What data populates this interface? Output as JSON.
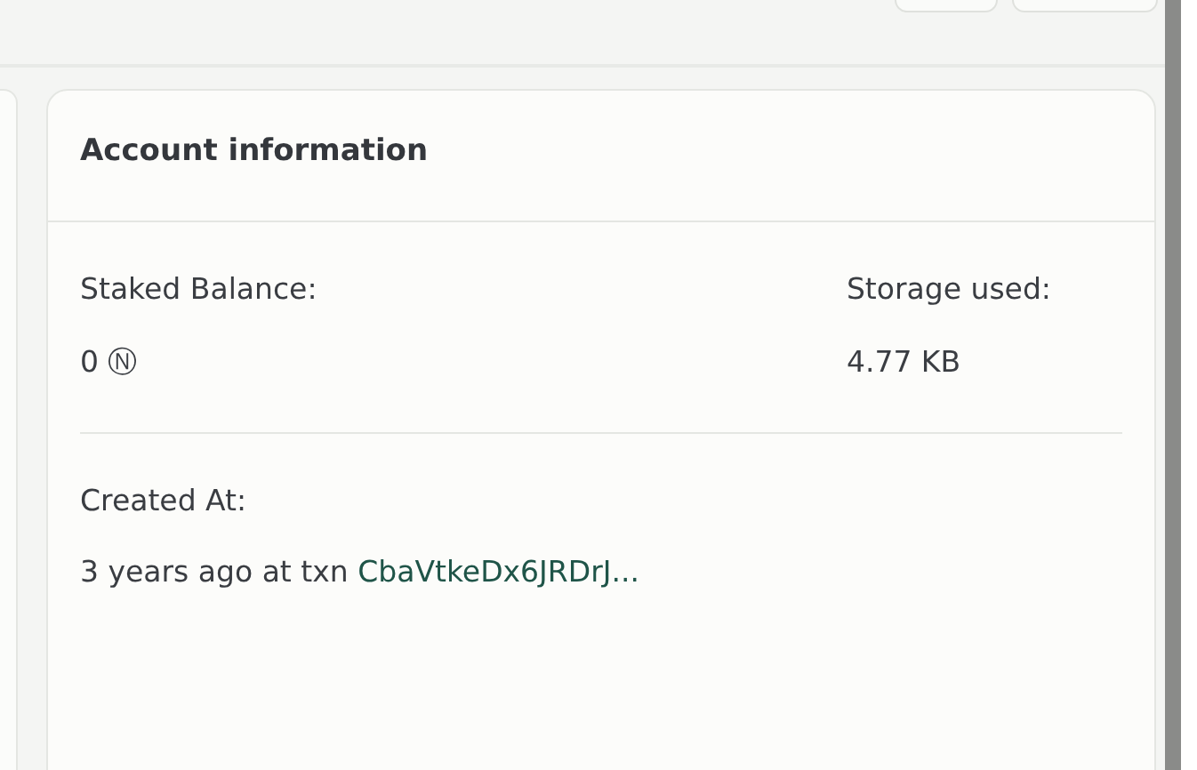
{
  "top_buttons": [
    {
      "kind": "small"
    },
    {
      "kind": "wide"
    }
  ],
  "card": {
    "title": "Account information",
    "fields": [
      {
        "label": "Staked Balance:",
        "value": "0 Ⓝ"
      },
      {
        "label": "Storage used:",
        "value": "4.77 KB"
      }
    ],
    "created": {
      "label": "Created At:",
      "value": "3 years ago at txn",
      "link": "CbaVtkeDx6JRDrJ..."
    }
  }
}
